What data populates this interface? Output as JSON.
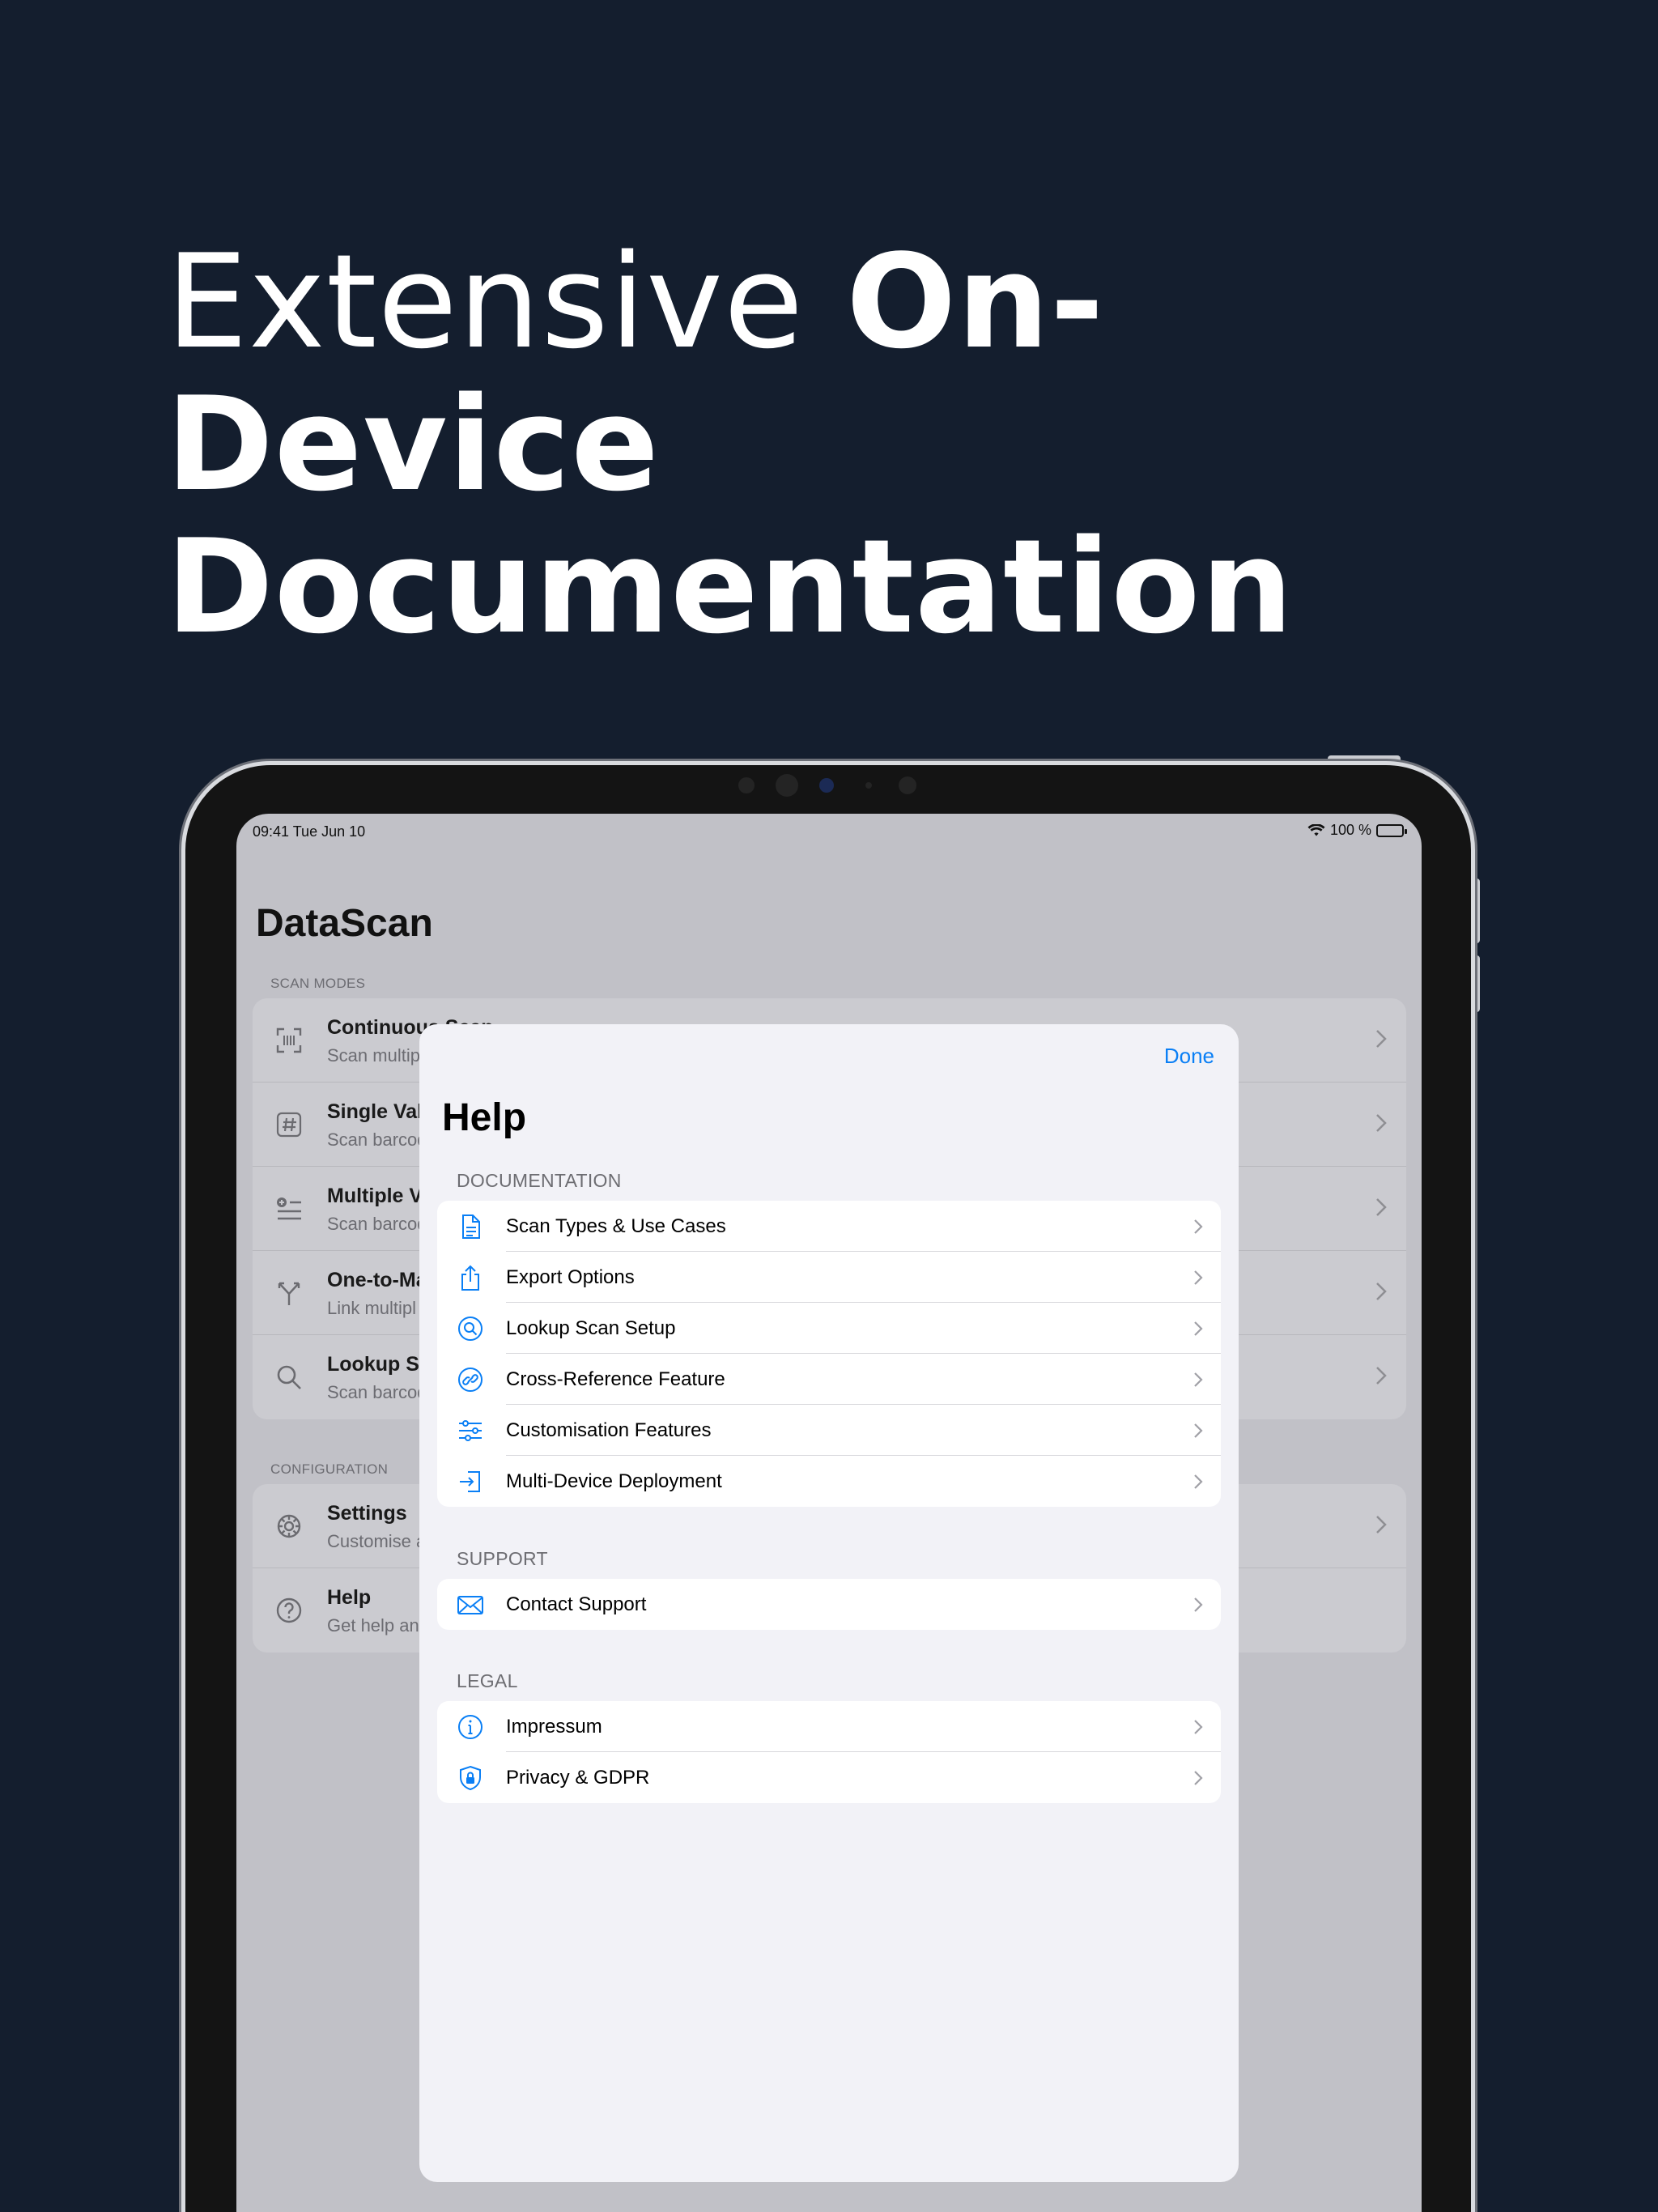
{
  "headline": {
    "line1_light": "Extensive",
    "line1_bold": "On-Device",
    "line2": "Documentation"
  },
  "status_bar": {
    "time": "09:41",
    "date": "Tue Jun 10",
    "battery": "100 %"
  },
  "background_app": {
    "title": "DataScan",
    "scan_modes_header": "SCAN MODES",
    "scan_modes": [
      {
        "title": "Continuous Scan",
        "subtitle": "Scan multip",
        "icon": "viewfinder-icon"
      },
      {
        "title": "Single Valu",
        "subtitle": "Scan barcod",
        "icon": "hash-icon"
      },
      {
        "title": "Multiple Va",
        "subtitle": "Scan barcod",
        "icon": "list-add-icon"
      },
      {
        "title": "One-to-Ma",
        "subtitle": "Link multipl",
        "icon": "branch-icon"
      },
      {
        "title": "Lookup Sc",
        "subtitle": "Scan barcod",
        "icon": "search-icon"
      }
    ],
    "configuration_header": "CONFIGURATION",
    "configuration": [
      {
        "title": "Settings",
        "subtitle": "Customise a",
        "icon": "gear-icon"
      },
      {
        "title": "Help",
        "subtitle": "Get help an",
        "icon": "question-icon"
      }
    ]
  },
  "help_modal": {
    "done_label": "Done",
    "title": "Help",
    "documentation_header": "DOCUMENTATION",
    "documentation": [
      {
        "label": "Scan Types & Use Cases",
        "icon": "document-icon"
      },
      {
        "label": "Export Options",
        "icon": "share-icon"
      },
      {
        "label": "Lookup Scan Setup",
        "icon": "search-circle-icon"
      },
      {
        "label": "Cross-Reference Feature",
        "icon": "link-icon"
      },
      {
        "label": "Customisation Features",
        "icon": "sliders-icon"
      },
      {
        "label": "Multi-Device Deployment",
        "icon": "import-icon"
      }
    ],
    "support_header": "SUPPORT",
    "support": [
      {
        "label": "Contact Support",
        "icon": "envelope-icon"
      }
    ],
    "legal_header": "LEGAL",
    "legal": [
      {
        "label": "Impressum",
        "icon": "info-icon"
      },
      {
        "label": "Privacy & GDPR",
        "icon": "shield-lock-icon"
      }
    ]
  },
  "colors": {
    "background": "#141e2e",
    "accent": "#0a7ff5"
  }
}
